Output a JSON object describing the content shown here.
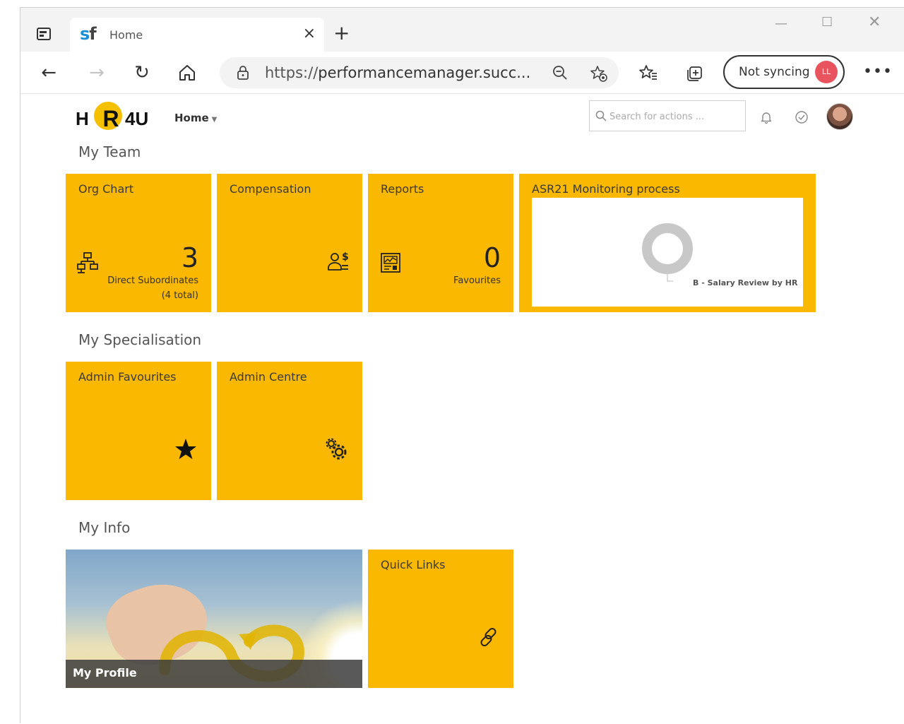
{
  "browser": {
    "tab_title": "Home",
    "tab_favicon_s": "s",
    "tab_favicon_f": "f",
    "url_scheme": "https://",
    "url_rest": "performancemanager.succ...",
    "sync_label": "Not syncing",
    "profile_initials": "LL"
  },
  "header": {
    "logo_h": "H",
    "logo_r": "R",
    "logo_4u": "4U",
    "home_menu": "Home",
    "search_placeholder": "Search for actions ..."
  },
  "sections": {
    "my_team": "My Team",
    "my_specialisation": "My Specialisation",
    "my_info": "My Info"
  },
  "tiles": {
    "org_chart": {
      "title": "Org Chart",
      "count": "3",
      "sub1": "Direct Subordinates",
      "sub2": "(4 total)"
    },
    "compensation": {
      "title": "Compensation"
    },
    "reports": {
      "title": "Reports",
      "count": "0",
      "sub1": "Favourites"
    },
    "asr21": {
      "title": "ASR21 Monitoring process"
    },
    "admin_favourites": {
      "title": "Admin Favourites"
    },
    "admin_centre": {
      "title": "Admin Centre"
    },
    "my_profile": {
      "title": "My Profile"
    },
    "quick_links": {
      "title": "Quick Links"
    }
  },
  "chart_data": {
    "type": "pie",
    "categories": [
      "B - Salary Review by HR"
    ],
    "values": [
      100
    ],
    "colors": [
      "#c8c8c8"
    ]
  },
  "colors": {
    "tile": "#fbb800",
    "logo_circle": "#f5c000",
    "sync_avatar": "#e9535e"
  }
}
